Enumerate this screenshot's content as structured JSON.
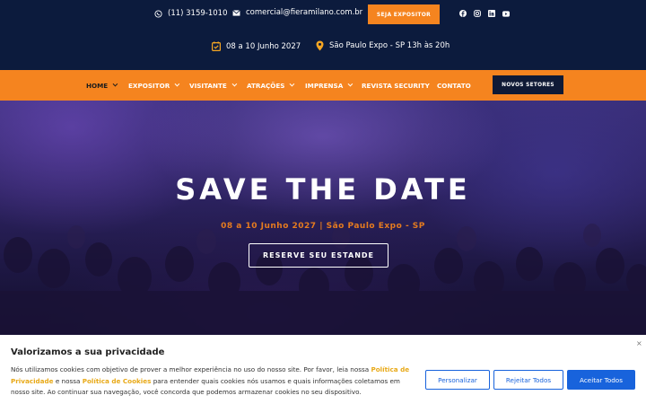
{
  "topbar": {
    "phone": "(11) 3159-1010",
    "email": "comercial@fieramilano.com.br",
    "expositor_button": "SEJA EXPOSITOR",
    "date": "08 a 10 Junho 2027",
    "venue": "São Paulo Expo - SP 13h às 20h",
    "socials": [
      "facebook-icon",
      "instagram-icon",
      "linkedin-icon",
      "youtube-icon"
    ]
  },
  "nav": {
    "items": [
      {
        "label": "HOME",
        "dropdown": true
      },
      {
        "label": "EXPOSITOR",
        "dropdown": true
      },
      {
        "label": "VISITANTE",
        "dropdown": true
      },
      {
        "label": "ATRAÇÕES",
        "dropdown": true
      },
      {
        "label": "IMPRENSA",
        "dropdown": true
      },
      {
        "label": "REVISTA SECURITY",
        "dropdown": false
      },
      {
        "label": "CONTATO",
        "dropdown": false
      }
    ],
    "cta": "NOVOS SETORES"
  },
  "hero": {
    "title": "SAVE THE DATE",
    "subtitle": "08 a 10 Junho 2027 | São Paulo Expo - SP",
    "button": "RESERVE SEU ESTANDE"
  },
  "cookie": {
    "title": "Valorizamos a sua privacidade",
    "text_1": "Nós utilizamos cookies com objetivo de prover a melhor experiência no uso do nosso site. Por favor, leia nossa ",
    "link_1": "Política de Privacidade",
    "text_2": " e nossa ",
    "link_2": "Política de Cookies",
    "text_3": " para entender quais cookies nós usamos e quais informações coletamos em nosso site. Ao continuar sua navegação, você concorda que podemos armazenar cookies no seu dispositivo.",
    "close": "×",
    "btn_personalizar": "Personalizar",
    "btn_rejeitar": "Rejeitar Todos",
    "btn_aceitar": "Aceitar Todos"
  },
  "colors": {
    "brand_orange": "#f5841f",
    "navy": "#0c1b3d",
    "cookie_blue": "#1863dc",
    "link_yellow": "#e8a917"
  }
}
